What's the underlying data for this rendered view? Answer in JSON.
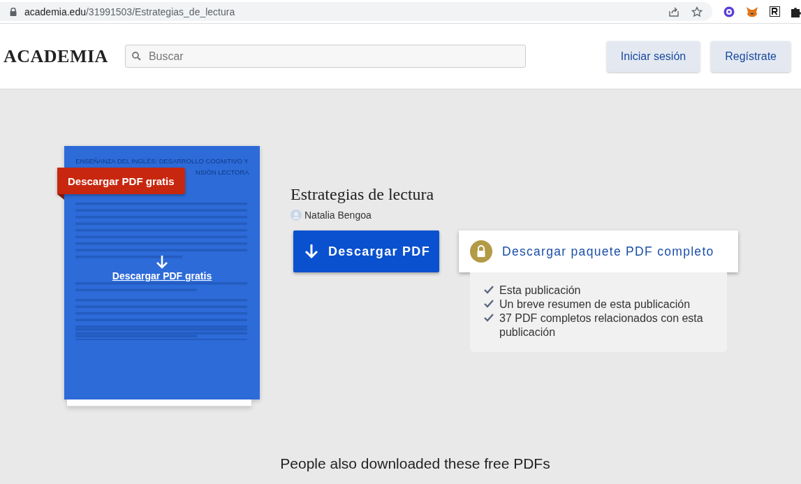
{
  "browser": {
    "url_host": "academia.edu",
    "url_path": "/31991503/Estrategias_de_lectura"
  },
  "header": {
    "logo": "ACADEMIA",
    "search": {
      "placeholder": "Buscar"
    },
    "buttons": [
      "Iniciar sesión",
      "Regístrate"
    ]
  },
  "preview": {
    "title_lines": [
      "ENSEÑANZA DEL INGLÉS: DESARROLLO COGNITIVO Y",
      "NSIÓN LECTORA"
    ],
    "badge": "Descargar PDF gratis",
    "link": "Descargar PDF gratis"
  },
  "paper": {
    "title": "Estrategias de lectura",
    "author": "Natalia Bengoa",
    "download_button": "Descargar PDF",
    "bundle_button": "Descargar paquete PDF completo",
    "features": [
      "Esta publicación",
      "Un breve resumen de esta publicación",
      "37 PDF completos relacionados con esta publicación"
    ]
  },
  "related_heading": "People also downloaded these free PDFs"
}
